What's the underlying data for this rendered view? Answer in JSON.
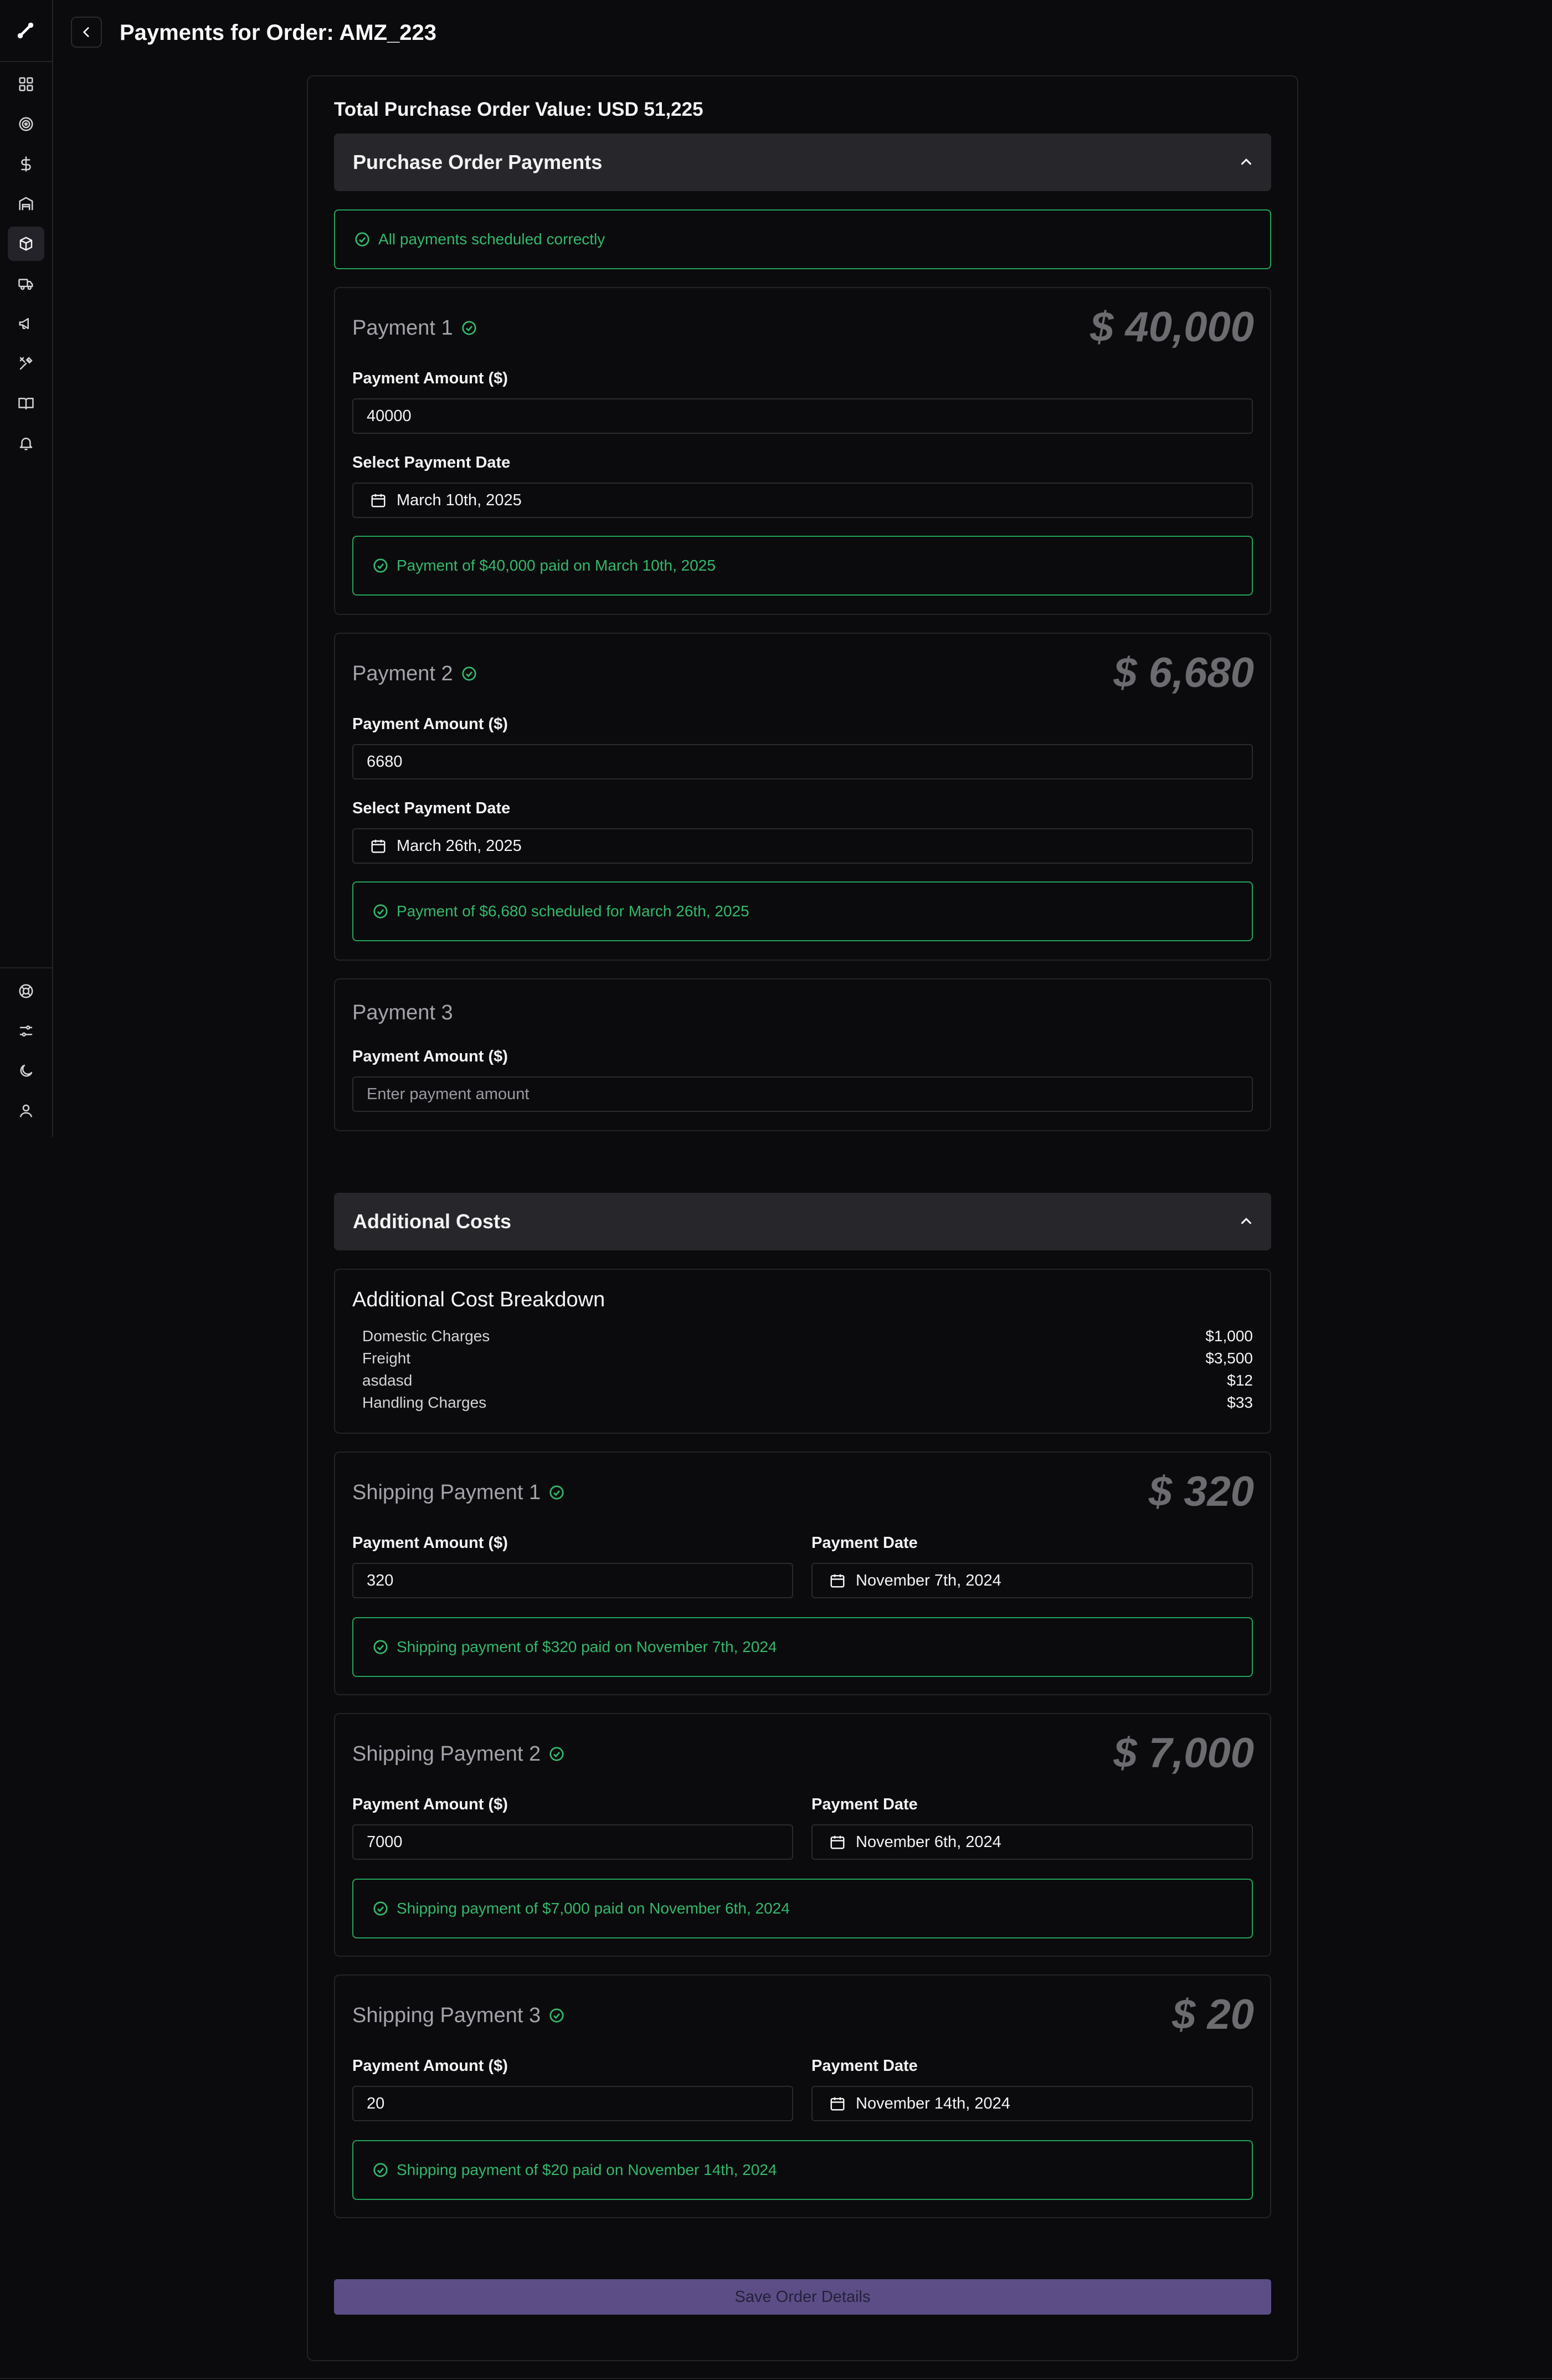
{
  "header": {
    "title": "Payments for Order: AMZ_223"
  },
  "summary": {
    "total_label": "Total Purchase Order Value: USD 51,225"
  },
  "sidebar": {
    "top_items": [
      {
        "icon": "dashboard-icon"
      },
      {
        "icon": "target-icon"
      },
      {
        "icon": "dollar-icon"
      },
      {
        "icon": "warehouse-icon"
      },
      {
        "icon": "package-icon",
        "active": true
      },
      {
        "icon": "truck-icon"
      },
      {
        "icon": "megaphone-icon"
      },
      {
        "icon": "tools-icon"
      },
      {
        "icon": "book-icon"
      },
      {
        "icon": "bell-icon"
      }
    ],
    "bottom_items": [
      {
        "icon": "help-icon"
      },
      {
        "icon": "settings-icon"
      },
      {
        "icon": "moon-icon"
      },
      {
        "icon": "user-icon"
      }
    ]
  },
  "po_section": {
    "title": "Purchase Order Payments",
    "status": "All payments scheduled correctly",
    "payments": [
      {
        "title": "Payment 1",
        "big_amount": "$ 40,000",
        "amount_label": "Payment Amount ($)",
        "amount": "40000",
        "date_label": "Select Payment Date",
        "date": "March 10th, 2025",
        "status": "Payment of $40,000 paid on March 10th, 2025"
      },
      {
        "title": "Payment 2",
        "big_amount": "$ 6,680",
        "amount_label": "Payment Amount ($)",
        "amount": "6680",
        "date_label": "Select Payment Date",
        "date": "March 26th, 2025",
        "status": "Payment of $6,680 scheduled for March 26th, 2025"
      },
      {
        "title": "Payment 3",
        "amount_label": "Payment Amount ($)",
        "placeholder": "Enter payment amount"
      }
    ]
  },
  "additional_costs": {
    "title": "Additional Costs",
    "breakdown_title": "Additional Cost Breakdown",
    "items": [
      {
        "label": "Domestic Charges",
        "value": "$1,000"
      },
      {
        "label": "Freight",
        "value": "$3,500"
      },
      {
        "label": "asdasd",
        "value": "$12"
      },
      {
        "label": "Handling Charges",
        "value": "$33"
      }
    ],
    "shipping_payments": [
      {
        "title": "Shipping Payment 1",
        "big_amount": "$ 320",
        "amount_label": "Payment Amount ($)",
        "amount": "320",
        "date_label": "Payment Date",
        "date": "November 7th, 2024",
        "status": "Shipping payment of $320 paid on November 7th, 2024"
      },
      {
        "title": "Shipping Payment 2",
        "big_amount": "$ 7,000",
        "amount_label": "Payment Amount ($)",
        "amount": "7000",
        "date_label": "Payment Date",
        "date": "November 6th, 2024",
        "status": "Shipping payment of $7,000 paid on November 6th, 2024"
      },
      {
        "title": "Shipping Payment 3",
        "big_amount": "$ 20",
        "amount_label": "Payment Amount ($)",
        "amount": "20",
        "date_label": "Payment Date",
        "date": "November 14th, 2024",
        "status": "Shipping payment of $20 paid on November 14th, 2024"
      }
    ]
  },
  "actions": {
    "save_label": "Save Order Details"
  },
  "colors": {
    "background": "#0b0b0d",
    "success": "#22a35a",
    "accent_button": "#5c4d86",
    "muted_amount": "#6b6b70"
  }
}
